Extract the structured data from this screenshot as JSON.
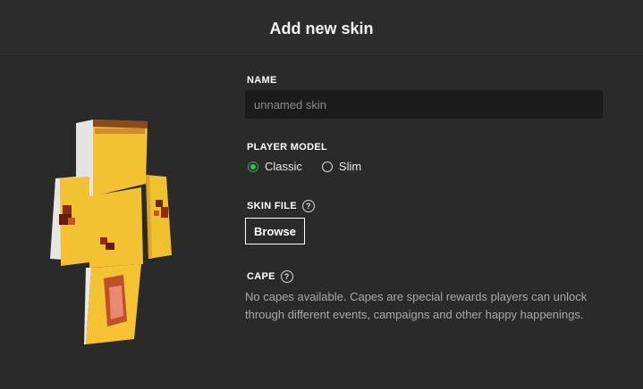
{
  "header": {
    "title": "Add new skin"
  },
  "preview": {
    "icon": "player-skin-preview",
    "colors": {
      "skin": "#f2c232",
      "hair": "#8a4a1a",
      "side": "#e8e8e8",
      "spot": "#a03010"
    }
  },
  "name": {
    "label": "NAME",
    "placeholder": "unnamed skin",
    "value": ""
  },
  "player_model": {
    "label": "PLAYER MODEL",
    "options": [
      {
        "label": "Classic",
        "selected": true
      },
      {
        "label": "Slim",
        "selected": false
      }
    ]
  },
  "skin_file": {
    "label": "SKIN FILE",
    "help_icon": "?",
    "browse_label": "Browse"
  },
  "cape": {
    "label": "CAPE",
    "help_icon": "?",
    "description": "No capes available. Capes are special rewards players can unlock through different events, campaigns and other happy happenings."
  },
  "colors": {
    "accent": "#27ce40",
    "background": "#2a2a2a",
    "input_bg": "#1b1b1b"
  }
}
